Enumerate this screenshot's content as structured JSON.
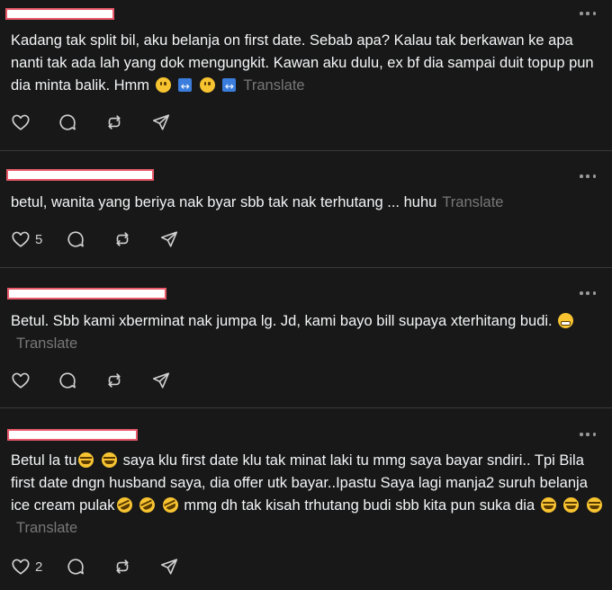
{
  "posts": [
    {
      "text_1": "Kadang tak split bil, aku belanja on first date. Sebab apa? Kalau tak berkawan ke apa nanti tak ada lah yang dok mengungkit. Kawan aku dulu, ex bf dia sampai duit topup pun dia minta balik. Hmm ",
      "translate": "Translate",
      "likes": ""
    },
    {
      "text_1": "betul, wanita yang beriya nak byar sbb tak nak terhutang ... huhu",
      "translate": "Translate",
      "likes": "5"
    },
    {
      "text_1": "Betul. Sbb kami xberminat nak jumpa lg. Jd, kami bayo bill supaya xterhitang budi. ",
      "translate": "Translate",
      "likes": ""
    },
    {
      "text_1": "Betul la tu",
      "text_2": " saya klu first date klu tak minat laki tu mmg saya bayar sndiri.. Tpi Bila first date dngn husband saya, dia offer utk bayar..Ipastu Saya lagi manja2 suruh belanja ice cream pulak",
      "text_3": " mmg dh tak kisah trhutang budi sbb kita pun suka dia ",
      "translate": "Translate",
      "likes": "2"
    }
  ],
  "icons": {
    "like": "heart-icon",
    "reply": "comment-icon",
    "repost": "repost-icon",
    "share": "send-icon",
    "more": "more-options-icon",
    "emoji_smile": "slightly-smiling-face-emoji",
    "emoji_arrow": "left-right-arrow-emoji",
    "emoji_laugh": "tears-of-joy-emoji",
    "emoji_rofl": "rolling-on-floor-laughing-emoji",
    "emoji_grimace": "grimacing-face-emoji"
  },
  "colors": {
    "background": "#181818",
    "text": "#f3f5f7",
    "muted": "#777777",
    "divider": "#3a3a3a",
    "redaction_fill": "#ffffff",
    "redaction_border": "#e8596a"
  }
}
